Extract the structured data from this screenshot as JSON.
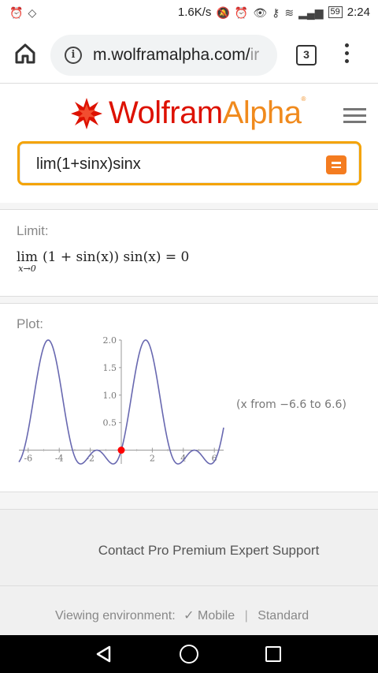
{
  "status_bar": {
    "net_speed": "1.6K/s",
    "battery": "59",
    "time": "2:24"
  },
  "browser": {
    "url_main": "m.wolframalpha.com/",
    "url_fade": "ir",
    "tab_count": "3"
  },
  "header": {
    "logo_part1": "Wolfram",
    "logo_part2": "Alpha",
    "logo_reg": "®"
  },
  "search": {
    "query": "lim(1+sinx)sinx"
  },
  "pods": {
    "limit": {
      "title": "Limit:",
      "lim_word": "lim",
      "lim_sub": "x→0",
      "expression": "(1 + sin(x)) sin(x) = 0"
    },
    "plot": {
      "title": "Plot:",
      "range_text": "(x from −6.6 to 6.6)"
    }
  },
  "chart_data": {
    "type": "line",
    "function": "(1 + sin(x)) sin(x)",
    "xlim": [
      -6.6,
      6.6
    ],
    "ylim": [
      -0.25,
      2.0
    ],
    "x_ticks": [
      "-6",
      "-4",
      "-2",
      "2",
      "4",
      "6"
    ],
    "y_ticks": [
      "0.5",
      "1.0",
      "1.5",
      "2.0"
    ],
    "highlight_point": [
      0,
      0
    ],
    "line_color": "#6868b0",
    "point_color": "#ff0000"
  },
  "footer": {
    "contact_text": "Contact Pro Premium Expert Support",
    "viewing_label": "Viewing environment:",
    "mobile_option": "✓ Mobile",
    "separator": "|",
    "standard_option": "Standard"
  },
  "colors": {
    "brand_red": "#dd1100",
    "brand_orange": "#f08a1d",
    "search_border": "#f4a300"
  }
}
